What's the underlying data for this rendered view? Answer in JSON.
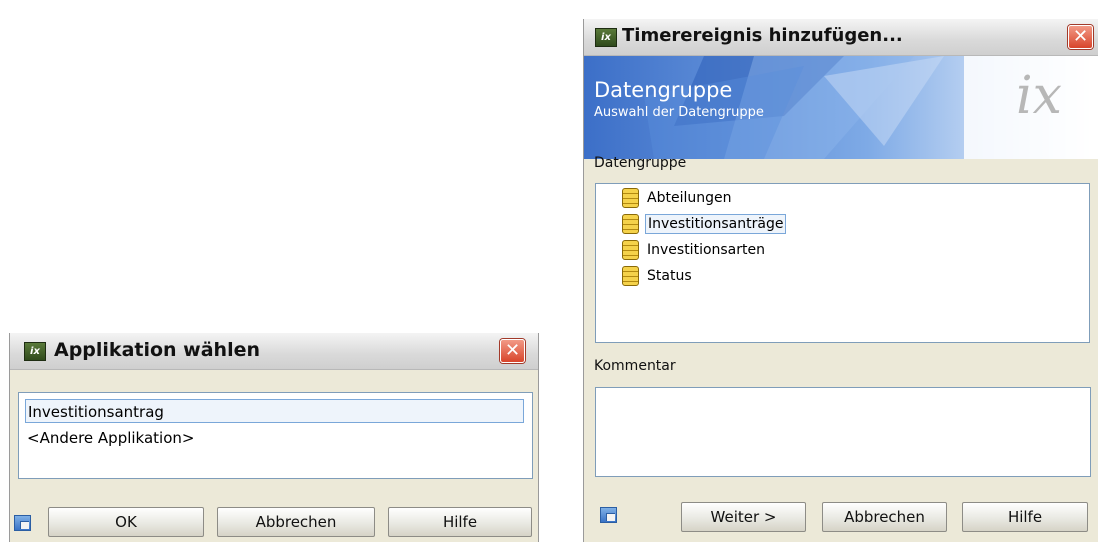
{
  "dialog_app": {
    "title": "Applikation wählen",
    "items": [
      "Investitionsantrag",
      "<Andere Applikation>"
    ],
    "buttons": {
      "ok": "OK",
      "cancel": "Abbrechen",
      "help": "Hilfe"
    }
  },
  "dialog_timer": {
    "title": "Timerereignis hinzufügen...",
    "banner": {
      "heading": "Datengruppe",
      "subheading": "Auswahl der Datengruppe",
      "logo": "ix"
    },
    "group_label": "Datengruppe",
    "groups": [
      "Abteilungen",
      "Investitionsanträge",
      "Investitionsarten",
      "Status"
    ],
    "comment_label": "Kommentar",
    "comment_value": "",
    "buttons": {
      "next": "Weiter >",
      "cancel": "Abbrechen",
      "help": "Hilfe"
    }
  },
  "colors": {
    "accent": "#316ac5",
    "banner_blue": "#4f86d6",
    "close_red": "#d8442b"
  }
}
